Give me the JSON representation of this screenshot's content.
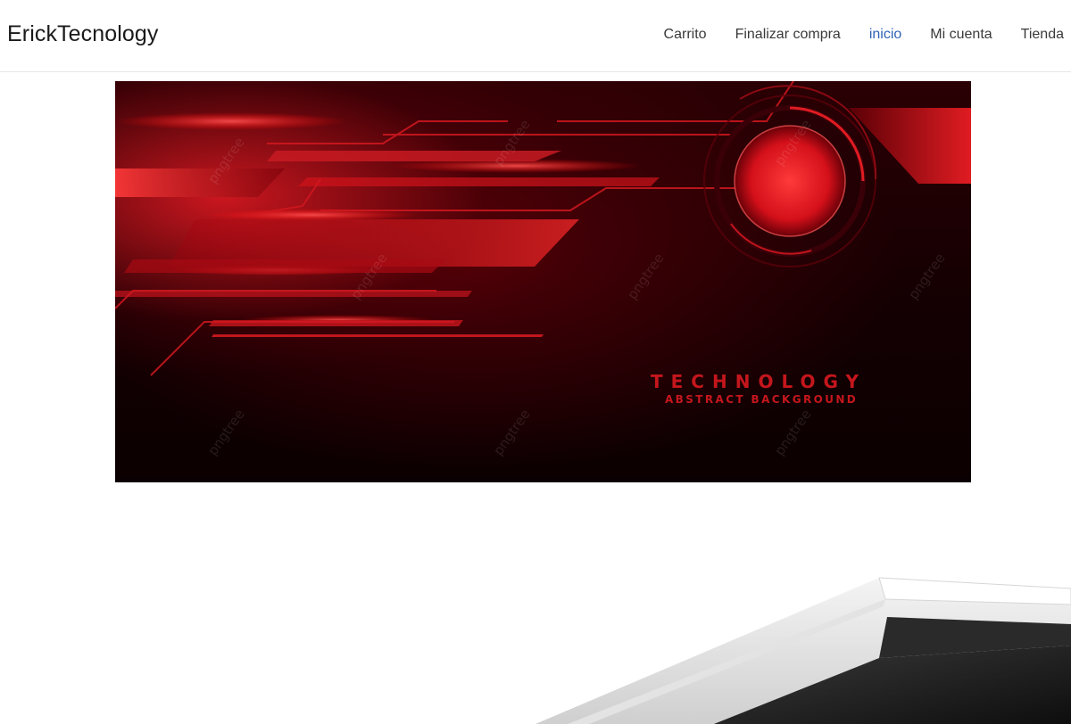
{
  "header": {
    "brand": "ErickTecnology",
    "nav": [
      {
        "label": "Carrito",
        "active": false
      },
      {
        "label": "Finalizar compra",
        "active": false
      },
      {
        "label": "inicio",
        "active": true
      },
      {
        "label": "Mi cuenta",
        "active": false
      },
      {
        "label": "Tienda",
        "active": false
      }
    ]
  },
  "banner": {
    "title": "TECHNOLOGY",
    "subtitle": "ABSTRACT BACKGROUND",
    "watermark": "pngtree"
  },
  "colors": {
    "accent": "#c4161c",
    "nav_active": "#2f63b5",
    "nav_text": "#3a3a3a",
    "brand_text": "#1a1a1a"
  }
}
